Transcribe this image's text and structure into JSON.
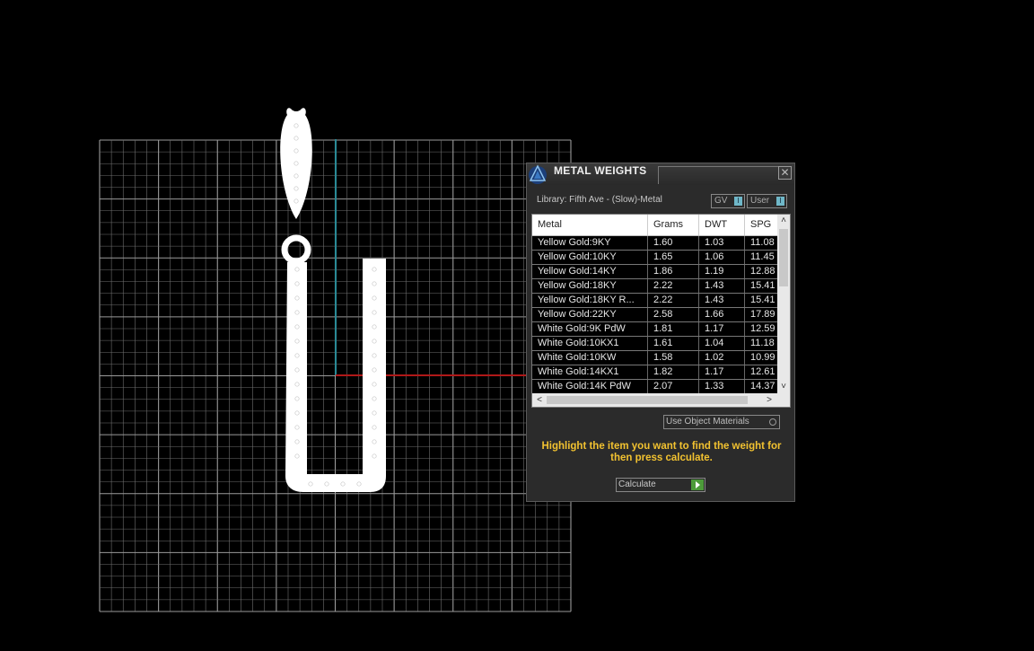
{
  "panel": {
    "title": "METAL WEIGHTS",
    "close_glyph": "✕",
    "library_label": "Library: Fifth Ave - (Slow)-Metal",
    "toggles": [
      {
        "label": "GV",
        "state": "I"
      },
      {
        "label": "User",
        "state": "I"
      }
    ],
    "table": {
      "headers": [
        "Metal",
        "Grams",
        "DWT",
        "SPG"
      ],
      "rows": [
        [
          "Yellow Gold:9KY",
          "1.60",
          "1.03",
          "11.08"
        ],
        [
          "Yellow Gold:10KY",
          "1.65",
          "1.06",
          "11.45"
        ],
        [
          "Yellow Gold:14KY",
          "1.86",
          "1.19",
          "12.88"
        ],
        [
          "Yellow Gold:18KY",
          "2.22",
          "1.43",
          "15.41"
        ],
        [
          "Yellow Gold:18KY R...",
          "2.22",
          "1.43",
          "15.41"
        ],
        [
          "Yellow Gold:22KY",
          "2.58",
          "1.66",
          "17.89"
        ],
        [
          "White Gold:9K PdW",
          "1.81",
          "1.17",
          "12.59"
        ],
        [
          "White Gold:10KX1",
          "1.61",
          "1.04",
          "11.18"
        ],
        [
          "White Gold:10KW",
          "1.58",
          "1.02",
          "10.99"
        ],
        [
          "White Gold:14KX1",
          "1.82",
          "1.17",
          "12.61"
        ],
        [
          "White Gold:14K PdW",
          "2.07",
          "1.33",
          "14.37"
        ]
      ],
      "scroll_up": "˄",
      "scroll_down": "˅",
      "scroll_left": "<",
      "scroll_right": ">"
    },
    "use_object_materials_label": "Use Object Materials",
    "hint": "Highlight the item you want to find the weight for then press calculate.",
    "calculate_label": "Calculate"
  },
  "colors": {
    "grid_line": "#6e6e6e",
    "grid_major": "#9a9a9a",
    "axis_x": "#b01818",
    "axis_y": "#2a8a96",
    "hint": "#f2c230",
    "accent_green": "#4d9b3a"
  }
}
